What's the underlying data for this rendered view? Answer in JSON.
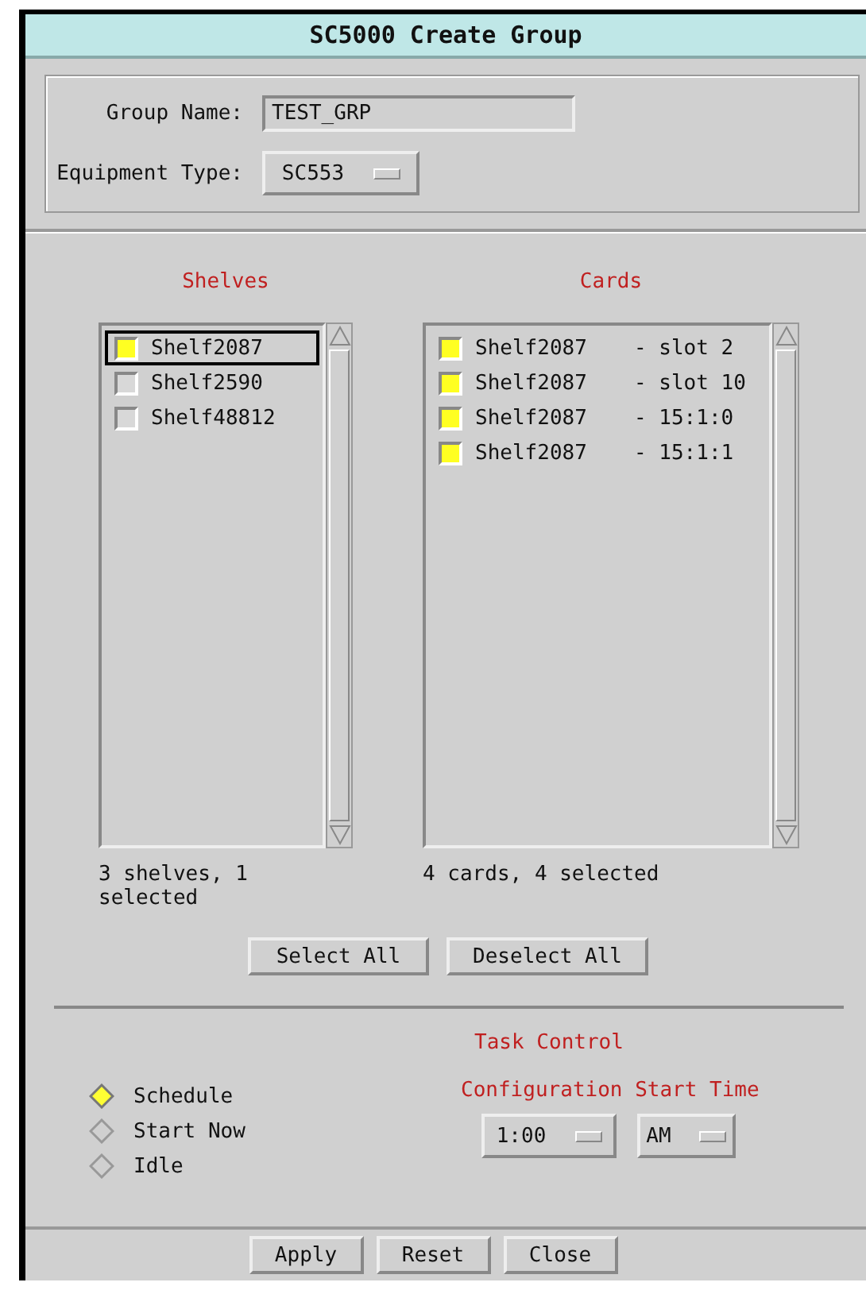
{
  "window": {
    "title": "SC5000 Create Group"
  },
  "group_name": {
    "label": "Group Name:",
    "value": "TEST_GRP"
  },
  "equipment_type": {
    "label": "Equipment Type:",
    "value": "SC553"
  },
  "shelves": {
    "heading": "Shelves",
    "summary": "3 shelves, 1 selected",
    "items": [
      {
        "name": "Shelf2087",
        "checked": true,
        "focused": true
      },
      {
        "name": "Shelf2590",
        "checked": false,
        "focused": false
      },
      {
        "name": "Shelf48812",
        "checked": false,
        "focused": false
      }
    ]
  },
  "cards": {
    "heading": "Cards",
    "summary": "4 cards, 4 selected",
    "items": [
      {
        "shelf": "Shelf2087",
        "slot": "- slot 2",
        "checked": true
      },
      {
        "shelf": "Shelf2087",
        "slot": "- slot 10",
        "checked": true
      },
      {
        "shelf": "Shelf2087",
        "slot": "- 15:1:0",
        "checked": true
      },
      {
        "shelf": "Shelf2087",
        "slot": "- 15:1:1",
        "checked": true
      }
    ]
  },
  "list_buttons": [
    "Select All",
    "Deselect All"
  ],
  "task_control": {
    "heading": "Task Control",
    "options": [
      {
        "label": "Schedule",
        "selected": true
      },
      {
        "label": "Start Now",
        "selected": false
      },
      {
        "label": "Idle",
        "selected": false
      }
    ],
    "start_time": {
      "heading": "Configuration Start Time",
      "time": "1:00",
      "period": "AM"
    }
  },
  "buttons": [
    "Apply",
    "Reset",
    "Close"
  ]
}
